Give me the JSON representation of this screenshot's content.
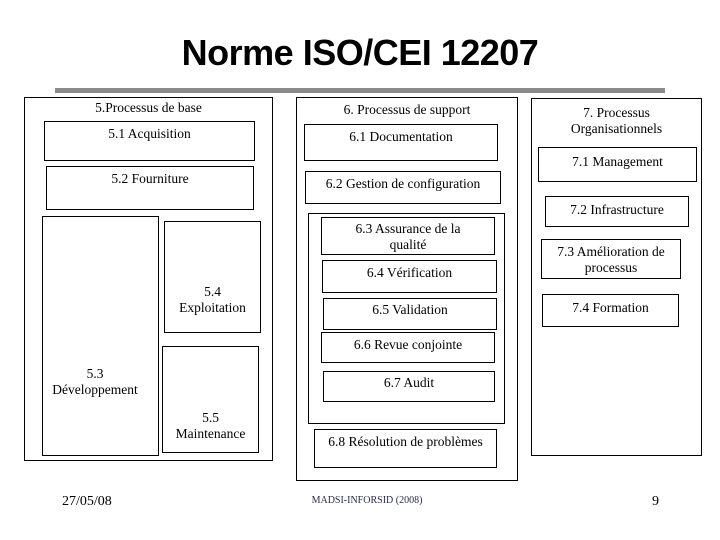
{
  "title": "Norme ISO/CEI 12207",
  "groups": {
    "base": {
      "title": "5.Processus de base",
      "items": {
        "acquisition": "5.1 Acquisition",
        "fourniture": "5.2 Fourniture",
        "developpement_num": "5.3",
        "developpement": "Développement",
        "exploitation_num": "5.4",
        "exploitation": "Exploitation",
        "maintenance_num": "5.5",
        "maintenance": "Maintenance"
      }
    },
    "support": {
      "title": "6. Processus de support",
      "items": {
        "documentation": "6.1 Documentation",
        "gestion_config": "6.2 Gestion de configuration",
        "assurance_qualite_1": "6.3 Assurance de la",
        "assurance_qualite_2": "qualité",
        "verification": "6.4 Vérification",
        "validation": "6.5 Validation",
        "revue_conjointe": "6.6 Revue conjointe",
        "audit": "6.7 Audit",
        "resolution": "6.8 Résolution de problèmes"
      }
    },
    "organisationnels": {
      "title_1": "7. Processus",
      "title_2": "Organisationnels",
      "items": {
        "management": "7.1 Management",
        "infrastructure": "7.2 Infrastructure",
        "amelioration_1": "7.3 Amélioration de",
        "amelioration_2": "processus",
        "formation": "7.4 Formation"
      }
    }
  },
  "footer": {
    "date": "27/05/08",
    "source": "MADSI-INFORSID (2008)",
    "page": "9"
  },
  "colors": {
    "title_rule": "#8a8a8a",
    "border": "#000000",
    "footer_source": "#2a2a4a"
  }
}
